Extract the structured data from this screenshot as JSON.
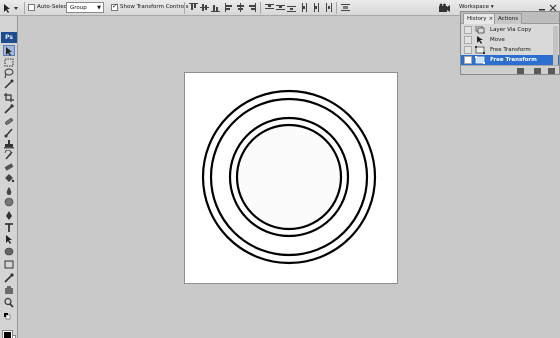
{
  "options_bar": {
    "auto_select_label": "Auto-Select:",
    "auto_select_checked": false,
    "auto_select_value": "Group",
    "show_transform_label": "Show Transform Controls",
    "show_transform_checked": true,
    "workspace_label": "Workspace"
  },
  "tools_panel": {
    "logo": "Ps",
    "tools": [
      "move-icon",
      "marquee-icon",
      "lasso-icon",
      "quick-select-icon",
      "crop-icon",
      "eyedropper-icon",
      "healing-icon",
      "brush-icon",
      "stamp-icon",
      "history-brush-icon",
      "eraser-icon",
      "bucket-icon",
      "blur-icon",
      "dodge-icon",
      "pen-icon",
      "type-icon",
      "path-select-icon",
      "shape-icon",
      "3d-icon",
      "hand-icon",
      "zoom-icon"
    ],
    "foreground_color": "#000000",
    "background_color": "#ffffff"
  },
  "history_panel": {
    "tabs": [
      {
        "label": "History",
        "close": "×",
        "active": true
      },
      {
        "label": "Actions",
        "active": false
      }
    ],
    "items": [
      {
        "label": "Layer Via Copy",
        "icon": "layer-via-copy-icon",
        "selected": false
      },
      {
        "label": "Move",
        "icon": "move-icon",
        "selected": false
      },
      {
        "label": "Free Transform",
        "icon": "transform-icon",
        "selected": false
      },
      {
        "label": "Free Transform",
        "icon": "transform-icon",
        "selected": true
      }
    ]
  },
  "colors": {
    "selection": "#2d6fd1",
    "ps_logo": "#1f4b8f"
  }
}
